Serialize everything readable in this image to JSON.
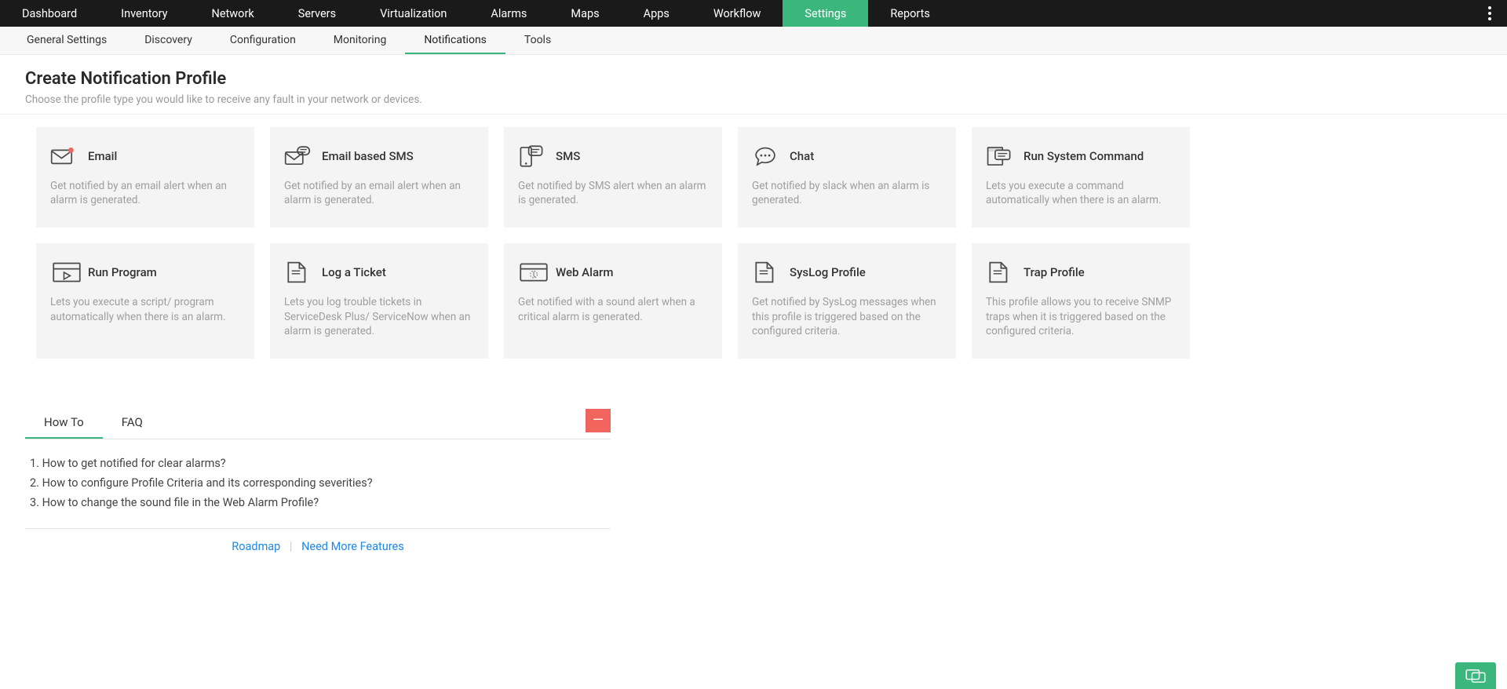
{
  "topnav": {
    "items": [
      {
        "label": "Dashboard"
      },
      {
        "label": "Inventory"
      },
      {
        "label": "Network"
      },
      {
        "label": "Servers"
      },
      {
        "label": "Virtualization"
      },
      {
        "label": "Alarms"
      },
      {
        "label": "Maps"
      },
      {
        "label": "Apps"
      },
      {
        "label": "Workflow"
      },
      {
        "label": "Settings",
        "active": true
      },
      {
        "label": "Reports"
      }
    ]
  },
  "subnav": {
    "items": [
      {
        "label": "General Settings"
      },
      {
        "label": "Discovery"
      },
      {
        "label": "Configuration"
      },
      {
        "label": "Monitoring"
      },
      {
        "label": "Notifications",
        "active": true
      },
      {
        "label": "Tools"
      }
    ]
  },
  "page": {
    "title": "Create Notification Profile",
    "subtitle": "Choose the profile type you would like to receive any fault in your network or devices."
  },
  "profiles": [
    {
      "id": "email",
      "title": "Email",
      "desc": "Get notified by an email alert when an alarm is generated.",
      "icon": "email-icon"
    },
    {
      "id": "email-sms",
      "title": "Email based SMS",
      "desc": "Get notified by an email alert when an alarm is generated.",
      "icon": "email-sms-icon"
    },
    {
      "id": "sms",
      "title": "SMS",
      "desc": "Get notified by SMS alert when an alarm is generated.",
      "icon": "sms-icon"
    },
    {
      "id": "chat",
      "title": "Chat",
      "desc": "Get notified by slack when an alarm is generated.",
      "icon": "chat-bubble-icon"
    },
    {
      "id": "run-system-command",
      "title": "Run System Command",
      "desc": "Lets you execute a command automatically when there is an alarm.",
      "icon": "system-command-icon"
    },
    {
      "id": "run-program",
      "title": "Run Program",
      "desc": "Lets you execute a script/ program automatically when there is an alarm.",
      "icon": "run-program-icon"
    },
    {
      "id": "log-ticket",
      "title": "Log a Ticket",
      "desc": "Lets you log trouble tickets in ServiceDesk Plus/ ServiceNow when an alarm is generated.",
      "icon": "ticket-icon"
    },
    {
      "id": "web-alarm",
      "title": "Web Alarm",
      "desc": "Get notified with a sound alert when a critical alarm is generated.",
      "icon": "web-alarm-icon"
    },
    {
      "id": "syslog",
      "title": "SysLog Profile",
      "desc": "Get notified by SysLog messages when this profile is triggered based on the configured criteria.",
      "icon": "syslog-icon"
    },
    {
      "id": "trap",
      "title": "Trap Profile",
      "desc": "This profile allows you to receive SNMP traps when it is triggered based on the configured criteria.",
      "icon": "trap-icon"
    }
  ],
  "help": {
    "tabs": [
      {
        "label": "How To",
        "active": true
      },
      {
        "label": "FAQ"
      }
    ],
    "howto_items": [
      "How to get notified for clear alarms?",
      "How to configure Profile Criteria and its corresponding severities?",
      "How to change the sound file in the Web Alarm Profile?"
    ],
    "footer": {
      "roadmap": "Roadmap",
      "need_more": "Need More Features"
    },
    "collapse_glyph": "—"
  }
}
